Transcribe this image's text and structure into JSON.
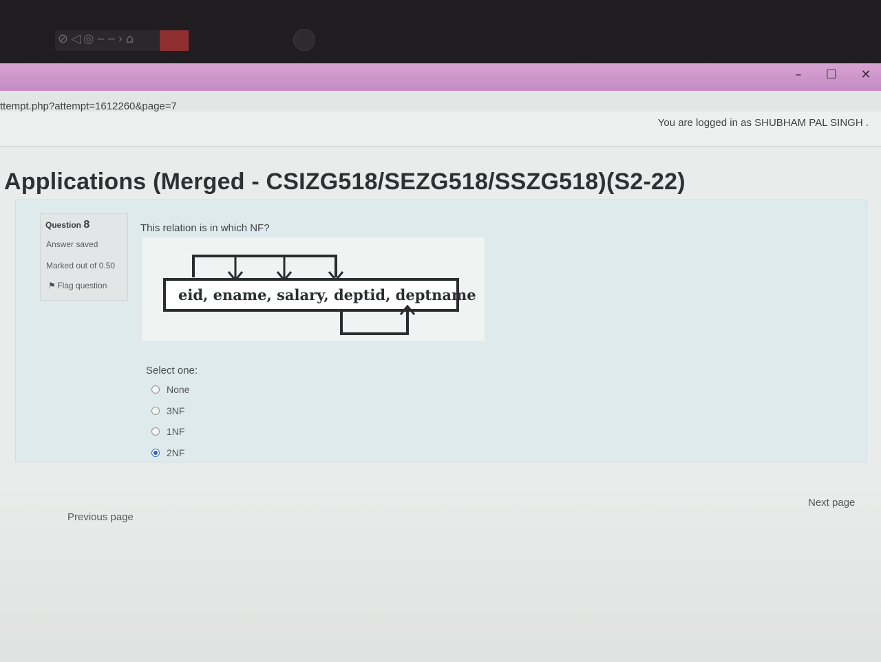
{
  "window": {
    "url": "ttempt.php?attempt=1612260&page=7",
    "minimize_glyph": "–",
    "maximize_glyph": "☐",
    "close_glyph": "✕"
  },
  "header": {
    "logged_in_text": "You are logged in as SHUBHAM PAL SINGH ."
  },
  "page": {
    "title": "Applications (Merged - CSIZG518/SEZG518/SSZG518)(S2-22)"
  },
  "question_info": {
    "label": "Question",
    "number": "8",
    "status": "Answer saved",
    "marks": "Marked out of 0.50",
    "flag_label": "Flag question"
  },
  "question": {
    "text": "This relation is in which NF?",
    "diagram_text": "eid,  ename, salary, deptid, deptname",
    "select_label": "Select one:",
    "options": [
      {
        "label": "None",
        "checked": false
      },
      {
        "label": "3NF",
        "checked": false
      },
      {
        "label": "1NF",
        "checked": false
      },
      {
        "label": "2NF",
        "checked": true
      }
    ]
  },
  "navigation": {
    "previous": "Previous page",
    "next": "Next page"
  },
  "colors": {
    "title_bar": "#c58bc4",
    "selected_radio": "#2f63c0"
  }
}
